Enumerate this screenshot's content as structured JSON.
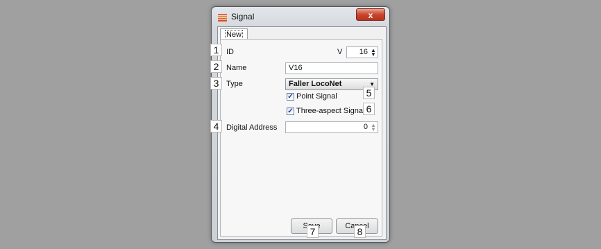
{
  "window": {
    "title": "Signal",
    "close_label": "x"
  },
  "tab": {
    "label": "New"
  },
  "fields": {
    "id_label": "ID",
    "id_prefix": "V",
    "id_value": "16",
    "name_label": "Name",
    "name_value": "V16",
    "type_label": "Type",
    "type_value": "Faller LocoNet",
    "point_signal_label": "Point Signal",
    "point_signal_checked": true,
    "three_aspect_label": "Three-aspect Signal",
    "three_aspect_checked": true,
    "digital_address_label": "Digital Address",
    "digital_address_value": "0"
  },
  "buttons": {
    "save": "Save",
    "cancel": "Cancel"
  },
  "callouts": [
    "1",
    "2",
    "3",
    "4",
    "5",
    "6",
    "7",
    "8"
  ],
  "icons": {
    "app": "signal-app-icon",
    "close": "close-icon",
    "dropdown": "chevron-down-icon",
    "spin": "spin-arrows-icon",
    "check": "checkmark-icon"
  }
}
